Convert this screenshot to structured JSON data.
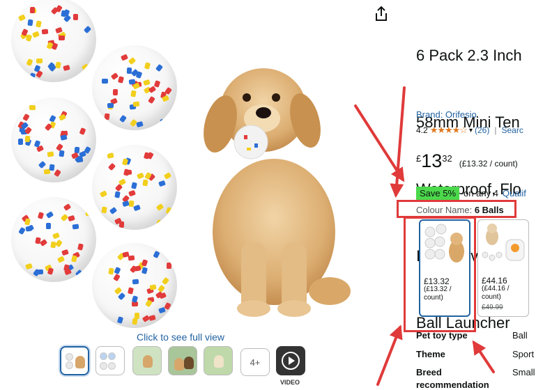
{
  "gallery": {
    "see_full_view": "Click to see full view",
    "more_thumbnails": "4+",
    "video_label": "VIDEO"
  },
  "product": {
    "title_lines": [
      "6 Pack 2.3 Inch",
      "58mm Mini Ten",
      "Waterproof, Flo",
      "Interactive Pet T",
      "Ball Launcher"
    ],
    "brand": "Brand: Orifesio",
    "rating": "4.2",
    "stars_text": "★★★★☆",
    "review_count": "(26)",
    "search_link": "Searc",
    "price": {
      "currency": "£",
      "whole": "13",
      "fraction": "32",
      "per_unit": "(£13.32 / count)"
    },
    "save": {
      "badge": "Save 5%",
      "text": "on any 4",
      "link": "Qualif"
    },
    "colour": {
      "label": "Colour Name:",
      "value": "6 Balls"
    }
  },
  "variants": [
    {
      "price": "£13.32",
      "unit": "(£13.32 / count)",
      "strike": ""
    },
    {
      "price": "£44.16",
      "unit": "(£44.16 / count)",
      "strike": "£49.99"
    }
  ],
  "attributes": [
    {
      "key": "Pet toy type",
      "value": "Ball"
    },
    {
      "key": "Theme",
      "value": "Sport"
    },
    {
      "key": "Breed",
      "value": "Small"
    },
    {
      "key": "recommendation",
      "value": ""
    }
  ],
  "colors": {
    "accent_link": "#2162a1",
    "star": "#de7921",
    "annotation": "#e03a3a",
    "save_badge": "#4bd94b"
  }
}
